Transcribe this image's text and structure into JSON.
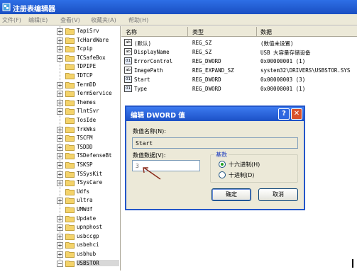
{
  "window": {
    "title": "注册表编辑器"
  },
  "menu": [
    "文件(F)",
    "编辑(E)",
    "查看(V)",
    "收藏夹(A)",
    "帮助(H)"
  ],
  "tree": {
    "items": [
      {
        "label": "TapiSrv",
        "expandable": true
      },
      {
        "label": "TcHardWare",
        "expandable": true
      },
      {
        "label": "Tcpip",
        "expandable": true
      },
      {
        "label": "TCSafeBox",
        "expandable": true
      },
      {
        "label": "TDPIPE",
        "expandable": false
      },
      {
        "label": "TDTCP",
        "expandable": false
      },
      {
        "label": "TermDD",
        "expandable": true
      },
      {
        "label": "TermService",
        "expandable": true
      },
      {
        "label": "Themes",
        "expandable": true
      },
      {
        "label": "TlntSvr",
        "expandable": true
      },
      {
        "label": "TosIde",
        "expandable": false
      },
      {
        "label": "TrkWks",
        "expandable": true
      },
      {
        "label": "TSCFM",
        "expandable": true
      },
      {
        "label": "TSDDD",
        "expandable": true
      },
      {
        "label": "TSDefenseBt",
        "expandable": true
      },
      {
        "label": "TSKSP",
        "expandable": true
      },
      {
        "label": "TSSysKit",
        "expandable": true
      },
      {
        "label": "TSysCare",
        "expandable": true
      },
      {
        "label": "Udfs",
        "expandable": false
      },
      {
        "label": "ultra",
        "expandable": true
      },
      {
        "label": "UMWdf",
        "expandable": false
      },
      {
        "label": "Update",
        "expandable": true
      },
      {
        "label": "upnphost",
        "expandable": true
      },
      {
        "label": "usbccgp",
        "expandable": true
      },
      {
        "label": "usbehci",
        "expandable": true
      },
      {
        "label": "usbhub",
        "expandable": true
      },
      {
        "label": "USBSTOR",
        "expandable": true,
        "selected": true,
        "expanded": true
      }
    ]
  },
  "list": {
    "headers": {
      "name": "名称",
      "type": "类型",
      "data": "数据"
    },
    "rows": [
      {
        "icon": "ab",
        "name": "(默认)",
        "type": "REG_SZ",
        "data": "(数值未设置)"
      },
      {
        "icon": "ab",
        "name": "DisplayName",
        "type": "REG_SZ",
        "data": "USB 大容量存储设备"
      },
      {
        "icon": "bin",
        "name": "ErrorControl",
        "type": "REG_DWORD",
        "data": "0x00000001 (1)"
      },
      {
        "icon": "ab",
        "name": "ImagePath",
        "type": "REG_EXPAND_SZ",
        "data": "system32\\DRIVERS\\USBSTOR.SYS"
      },
      {
        "icon": "bin",
        "name": "Start",
        "type": "REG_DWORD",
        "data": "0x00000003 (3)"
      },
      {
        "icon": "bin",
        "name": "Type",
        "type": "REG_DWORD",
        "data": "0x00000001 (1)"
      }
    ]
  },
  "dialog": {
    "title": "编辑 DWORD 值",
    "help": "?",
    "close": "✕",
    "name_label": "数值名称(N):",
    "name_value": "Start",
    "data_label": "数值数据(V):",
    "data_value": "3",
    "base_label": "基数",
    "radio_hex": "十六进制(H)",
    "radio_dec": "十进制(D)",
    "ok": "确定",
    "cancel": "取消"
  }
}
